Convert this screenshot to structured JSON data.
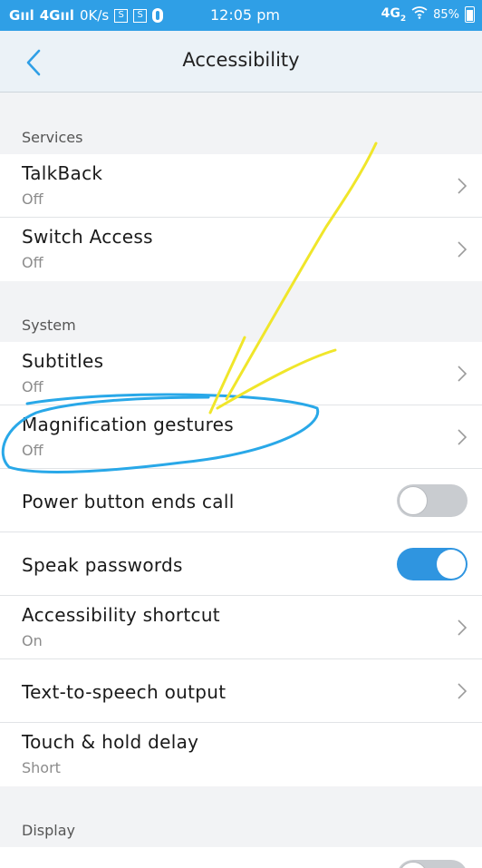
{
  "status_bar": {
    "signal1": "G",
    "signal2": "4G",
    "speed": "0K/s",
    "notif1": "S",
    "notif2": "S",
    "time": "12:05 pm",
    "network": "4G",
    "network_sub": "2",
    "battery": "85%"
  },
  "app_bar": {
    "title": "Accessibility"
  },
  "sections": {
    "services": "Services",
    "system": "System",
    "display": "Display"
  },
  "services": [
    {
      "label": "TalkBack",
      "sub": "Off"
    },
    {
      "label": "Switch Access",
      "sub": "Off"
    }
  ],
  "system": {
    "subtitles": {
      "label": "Subtitles",
      "sub": "Off"
    },
    "magnification": {
      "label": "Magnification gestures",
      "sub": "Off"
    },
    "power_button": {
      "label": "Power button ends call",
      "state": false
    },
    "speak_passwords": {
      "label": "Speak passwords",
      "state": true
    },
    "shortcut": {
      "label": "Accessibility shortcut",
      "sub": "On"
    },
    "tts": {
      "label": "Text-to-speech output"
    },
    "touch_hold": {
      "label": "Touch & hold delay",
      "sub": "Short"
    }
  },
  "colors": {
    "accent": "#2f9fe6",
    "toggle_on": "#2f95e0",
    "annotation_circle": "#29a8e8",
    "annotation_arrow": "#f0e62a"
  }
}
